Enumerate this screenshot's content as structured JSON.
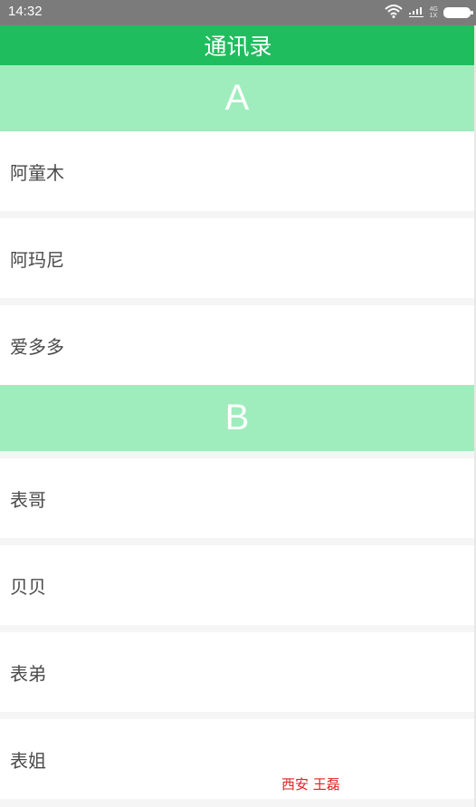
{
  "status_bar": {
    "time": "14:32",
    "network_top": "4G",
    "network_bottom": "1X",
    "icons": [
      "wifi-icon",
      "signal-icon",
      "signal-icon",
      "battery-icon"
    ]
  },
  "header": {
    "title": "通讯录"
  },
  "sections": [
    {
      "letter": "A",
      "contacts": [
        "阿童木",
        "阿玛尼",
        "爱多多"
      ]
    },
    {
      "letter": "B",
      "contacts": [
        "表哥",
        "贝贝",
        "表弟",
        "表姐"
      ]
    }
  ],
  "footer": {
    "credit": "西安 王磊"
  },
  "colors": {
    "status_bar": "#7b7b7b",
    "title_bar": "#20bd5f",
    "section_header": "#9fedbd",
    "credit_text": "#e02020"
  }
}
